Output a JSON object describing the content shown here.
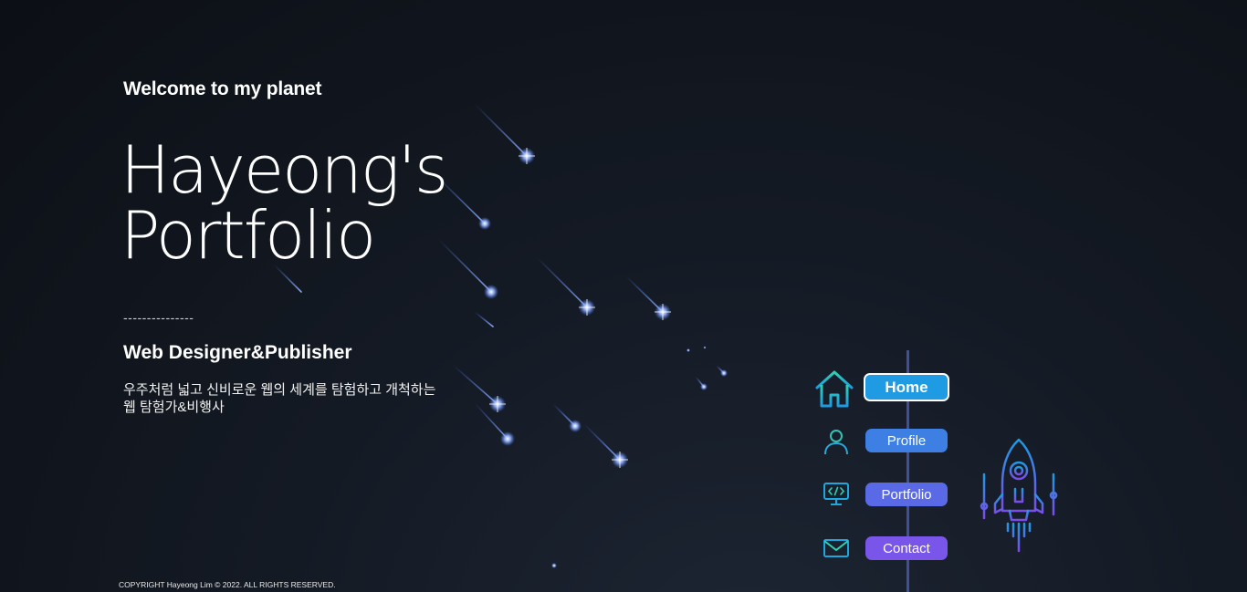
{
  "hero": {
    "tagline": "Welcome to my planet",
    "title_line1": "Hayeong's",
    "title_line2": "Portfolio",
    "divider": "---------------",
    "subtitle": "Web Designer&Publisher",
    "description_line1": "우주처럼 넓고 신비로운 웹의 세계를 탐험하고 개척하는",
    "description_line2": "웹 탐험가&비행사"
  },
  "nav": {
    "items": [
      {
        "label": "Home",
        "icon": "home-icon",
        "active": true,
        "color": "#1e9be2"
      },
      {
        "label": "Profile",
        "icon": "user-icon",
        "active": false,
        "color": "#3d7fe3"
      },
      {
        "label": "Portfolio",
        "icon": "monitor-code-icon",
        "active": false,
        "color": "#5a6ae6"
      },
      {
        "label": "Contact",
        "icon": "mail-icon",
        "active": false,
        "color": "#7a55e9"
      }
    ]
  },
  "decor": {
    "rocket_icon": "rocket-icon",
    "shooting_stars_icon": "shooting-stars-background"
  },
  "footer": {
    "copyright": "COPYRIGHT Hayeong Lim © 2022. ALL RIGHTS RESERVED."
  },
  "colors": {
    "background": "#141a24",
    "accent_teal": "#2fd0b4",
    "accent_blue": "#1e9be2",
    "accent_purple": "#7a55e9",
    "nav_line": "#3f4f9a"
  }
}
